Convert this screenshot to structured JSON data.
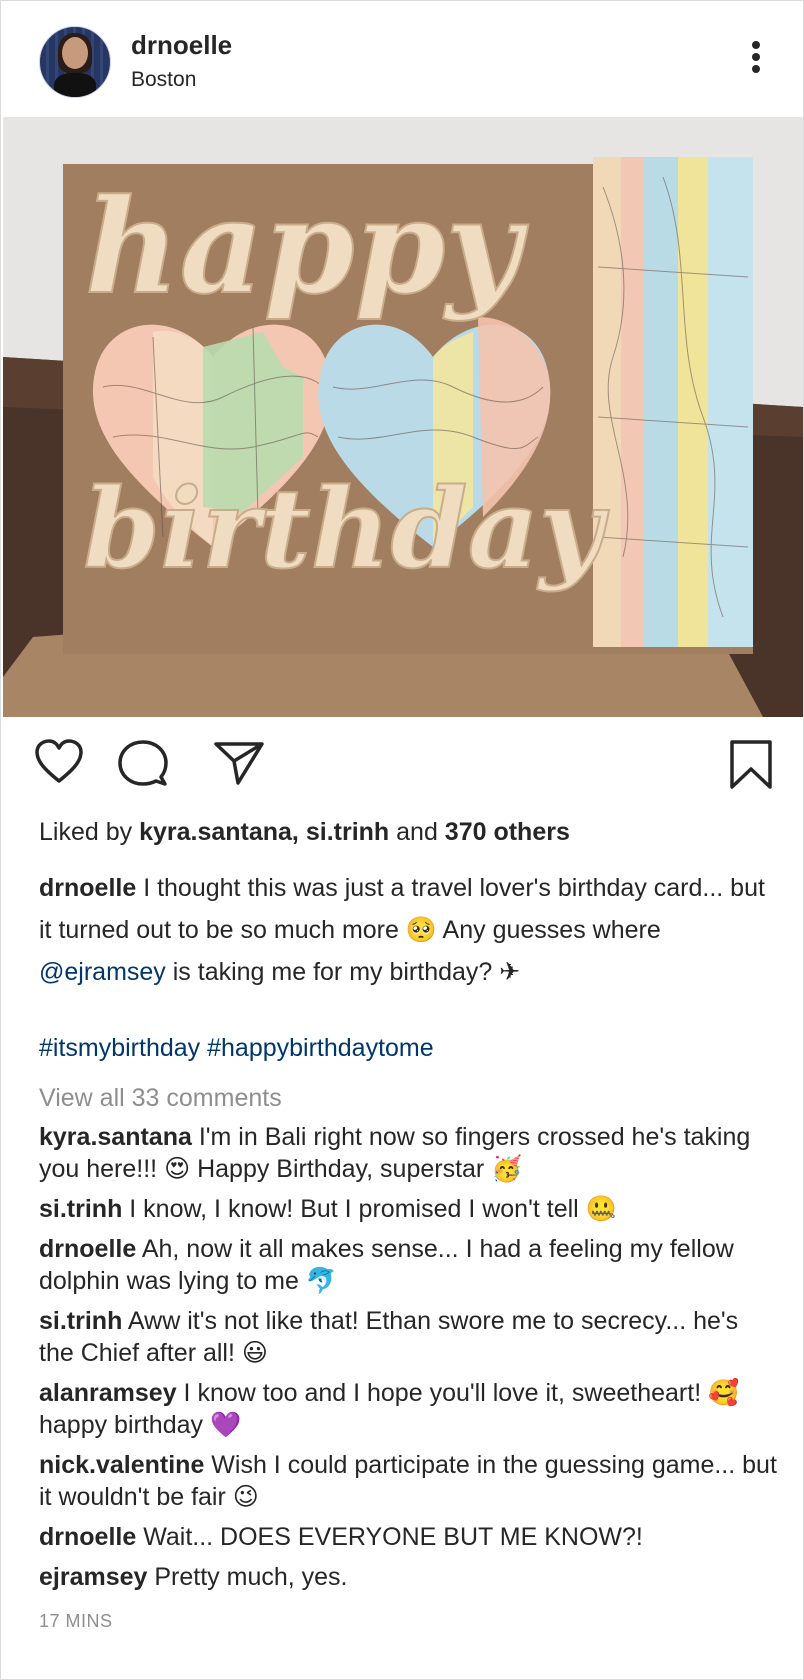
{
  "post": {
    "username": "drnoelle",
    "location": "Boston"
  },
  "photo": {
    "card_text_top": "happy",
    "card_text_bottom": "birthday"
  },
  "icons": {
    "like": "heart-icon",
    "comment": "comment-icon",
    "share": "send-icon",
    "save": "bookmark-icon",
    "more": "more-options-icon"
  },
  "likes": {
    "prefix": "Liked by ",
    "user1": "kyra.santana,",
    "user2": "si.trinh",
    "middle": " and ",
    "others": "370 others"
  },
  "caption": {
    "author": "drnoelle",
    "text_part1": " I thought this was just a travel lover's birthday card... but it turned out to be so much more 🥺  Any guesses where ",
    "mention": "@ejramsey",
    "text_part2": " is taking me for my birthday? ✈",
    "hashtags": "#itsmybirthday #happybirthdaytome"
  },
  "view_all": "View all  33 comments",
  "comments": [
    {
      "user": "kyra.santana",
      "text": " I'm in Bali right now so fingers crossed he's taking you here!!! 😍  Happy Birthday, superstar 🥳"
    },
    {
      "user": "si.trinh",
      "text": " I know, I know! But I promised I won't tell 🤐"
    },
    {
      "user": "drnoelle",
      "text": " Ah, now it all makes sense... I had a feeling my fellow dolphin was lying to me 🐬"
    },
    {
      "user": "si.trinh",
      "text": " Aww it's not like that! Ethan swore me to secrecy... he's the Chief after all! 😃"
    },
    {
      "user": "alanramsey",
      "text": " I know too and I hope you'll love it, sweetheart! 🥰 happy birthday 💜"
    },
    {
      "user": "nick.valentine",
      "text": " Wish I could participate in the guessing game... but it wouldn't be fair 😉"
    },
    {
      "user": "drnoelle",
      "text": " Wait... DOES EVERYONE BUT ME KNOW?!"
    },
    {
      "user": "ejramsey",
      "text": " Pretty much, yes."
    }
  ],
  "timestamp": "17 MINS"
}
